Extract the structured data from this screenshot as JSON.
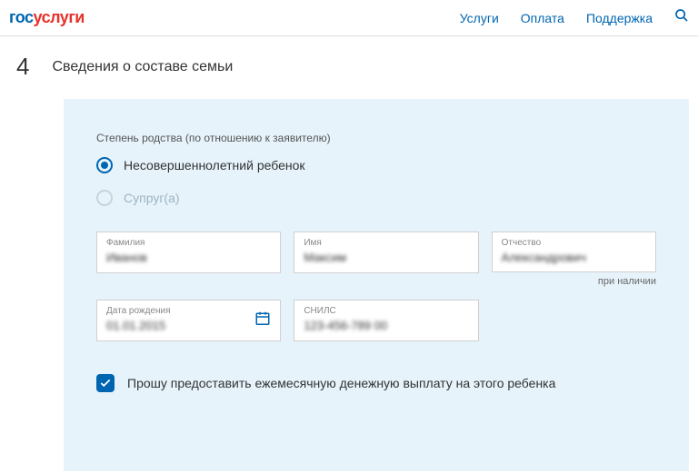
{
  "header": {
    "logo_part1": "гос",
    "logo_part2": "услуги",
    "nav": [
      "Услуги",
      "Оплата",
      "Поддержка"
    ]
  },
  "step": {
    "number": "4",
    "title": "Сведения о составе семьи"
  },
  "form": {
    "relationship_label": "Степень родства (по отношению к заявителю)",
    "radio_minor": "Несовершеннолетний ребенок",
    "radio_spouse": "Супруг(а)",
    "fields": {
      "lastname_label": "Фамилия",
      "lastname_value": "Иванов",
      "firstname_label": "Имя",
      "firstname_value": "Максим",
      "patronymic_label": "Отчество",
      "patronymic_value": "Александрович",
      "patronymic_note": "при наличии",
      "dob_label": "Дата рождения",
      "dob_value": "01.01.2015",
      "snils_label": "СНИЛС",
      "snils_value": "123-456-789 00"
    },
    "checkbox_label": "Прошу предоставить ежемесячную денежную выплату на этого ребенка"
  }
}
